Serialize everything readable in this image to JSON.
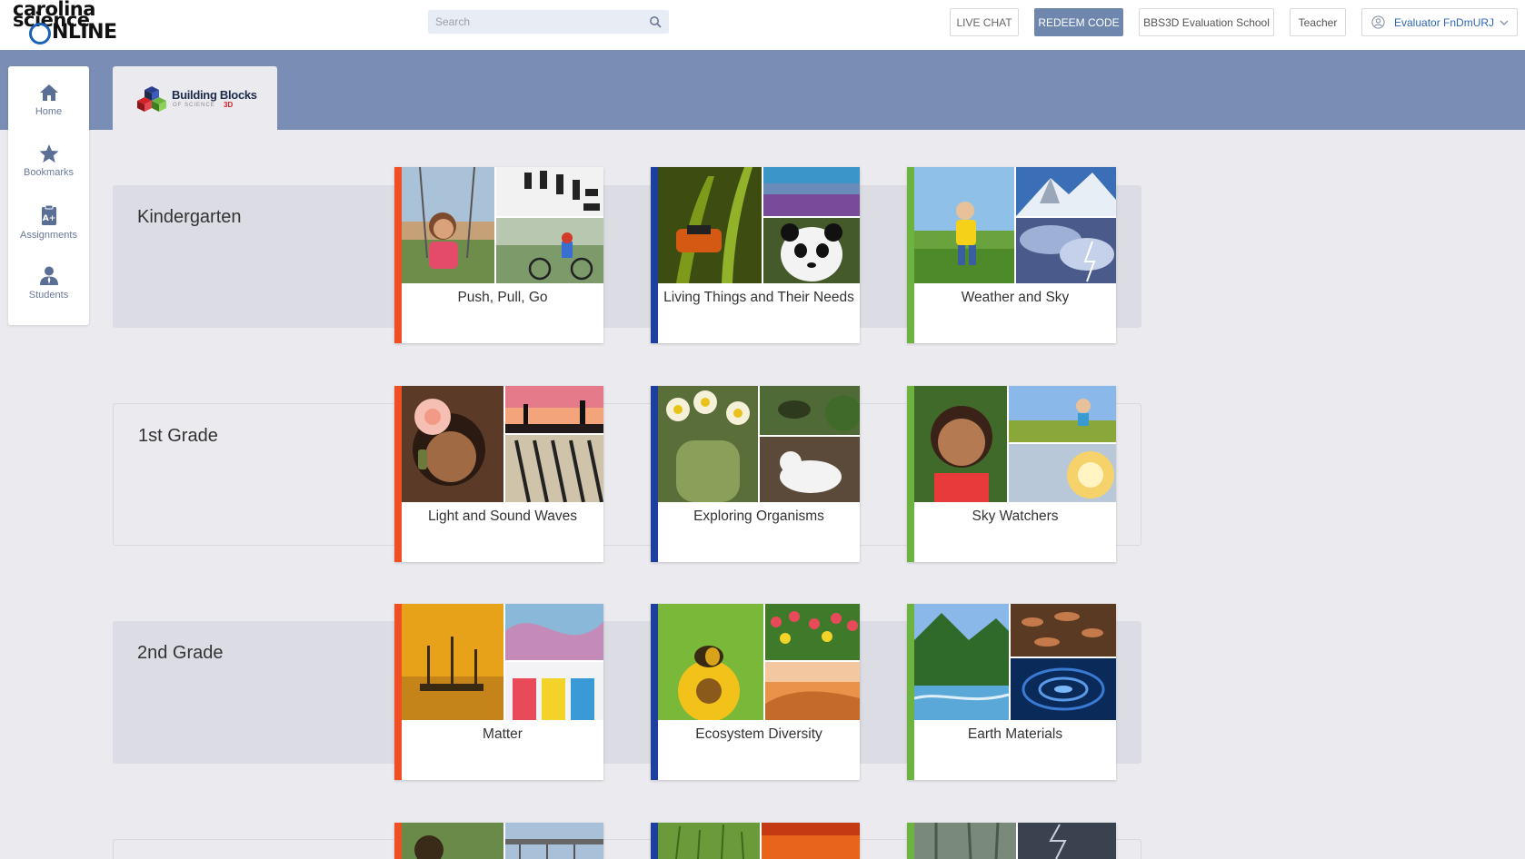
{
  "header": {
    "logo_line1": "carolina",
    "logo_line2": "science",
    "logo_line3": "NLINE",
    "search_placeholder": "Search",
    "live_chat": "LIVE CHAT",
    "redeem_code": "REDEEM CODE",
    "school": "BBS3D Evaluation School",
    "role": "Teacher",
    "user": "Evaluator FnDmURJ"
  },
  "product": {
    "title": "Building Blocks",
    "subtitle": "OF SCIENCE",
    "badge": "3D"
  },
  "sidebar": {
    "items": [
      {
        "label": "Home",
        "icon": "home-icon"
      },
      {
        "label": "Bookmarks",
        "icon": "star-icon"
      },
      {
        "label": "Assignments",
        "icon": "clipboard-icon"
      },
      {
        "label": "Students",
        "icon": "student-icon"
      }
    ]
  },
  "grades": [
    {
      "label": "Kindergarten",
      "units": [
        {
          "title": "Push, Pull, Go",
          "stripe": "#f04e23"
        },
        {
          "title": "Living Things and Their Needs",
          "stripe": "#1d3f9e"
        },
        {
          "title": "Weather and Sky",
          "stripe": "#6cb43f"
        }
      ]
    },
    {
      "label": "1st Grade",
      "units": [
        {
          "title": "Light and Sound Waves",
          "stripe": "#f04e23"
        },
        {
          "title": "Exploring Organisms",
          "stripe": "#1d3f9e"
        },
        {
          "title": "Sky Watchers",
          "stripe": "#6cb43f"
        }
      ]
    },
    {
      "label": "2nd Grade",
      "units": [
        {
          "title": "Matter",
          "stripe": "#f04e23"
        },
        {
          "title": "Ecosystem Diversity",
          "stripe": "#1d3f9e"
        },
        {
          "title": "Earth Materials",
          "stripe": "#6cb43f"
        }
      ]
    }
  ],
  "colors": {
    "physical": "#f04e23",
    "life": "#1d3f9e",
    "earth": "#6cb43f",
    "accent": "#6f86ad",
    "band": "#7a8eb5"
  }
}
